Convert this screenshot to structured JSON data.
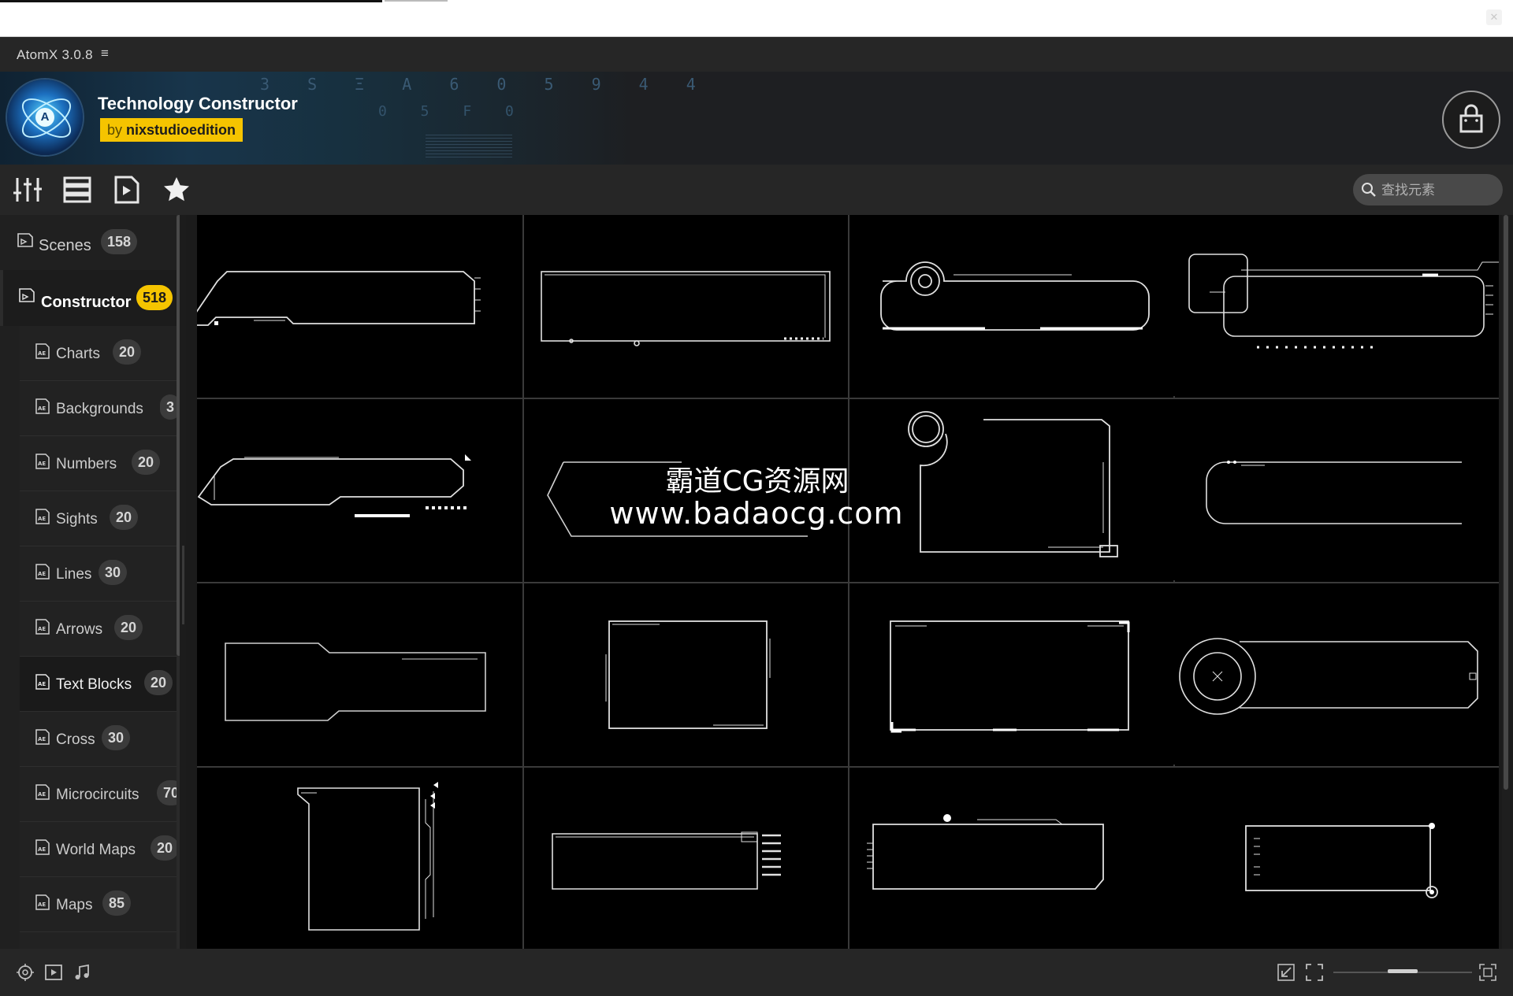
{
  "window": {
    "close_glyph": "✕"
  },
  "app": {
    "title": "AtomX 3.0.8",
    "menu_glyph": "≡"
  },
  "pack": {
    "title": "Technology Constructor",
    "author_prefix": "by",
    "author": "nixstudioedition",
    "logo_letter": "A"
  },
  "toolbar": {
    "icons": [
      "sliders-icon",
      "list-view-icon",
      "preview-play-icon",
      "star-icon"
    ]
  },
  "search": {
    "placeholder": "查找元素",
    "value": ""
  },
  "sidebar": {
    "categories": [
      {
        "label": "Scenes",
        "count": "158"
      },
      {
        "label": "Constructor",
        "count": "518"
      }
    ],
    "subcategories": [
      {
        "label": "Charts",
        "count": "20"
      },
      {
        "label": "Backgrounds",
        "count": "3"
      },
      {
        "label": "Numbers",
        "count": "20"
      },
      {
        "label": "Sights",
        "count": "20"
      },
      {
        "label": "Lines",
        "count": "30"
      },
      {
        "label": "Arrows",
        "count": "20"
      },
      {
        "label": "Text Blocks",
        "count": "20",
        "selected": true
      },
      {
        "label": "Cross",
        "count": "30"
      },
      {
        "label": "Microcircuits",
        "count": "70"
      },
      {
        "label": "World Maps",
        "count": "20"
      },
      {
        "label": "Maps",
        "count": "85"
      }
    ]
  },
  "grid": {
    "rows": 4,
    "columns": 4,
    "item_count": 16
  },
  "watermark": {
    "line1": "霸道CG资源网",
    "line2": "www.badaocg.com"
  },
  "footer": {
    "left_icons": [
      "compass-icon",
      "play-square-icon",
      "music-note-icon"
    ],
    "right_icons": [
      "shrink-icon",
      "fullscreen-icon",
      "grid-fit-icon"
    ],
    "zoom": 0.5
  },
  "colors": {
    "accent": "#f5c400",
    "background": "#1b1b1b",
    "grid_bg": "#000000",
    "line": "#e0e0e0"
  }
}
